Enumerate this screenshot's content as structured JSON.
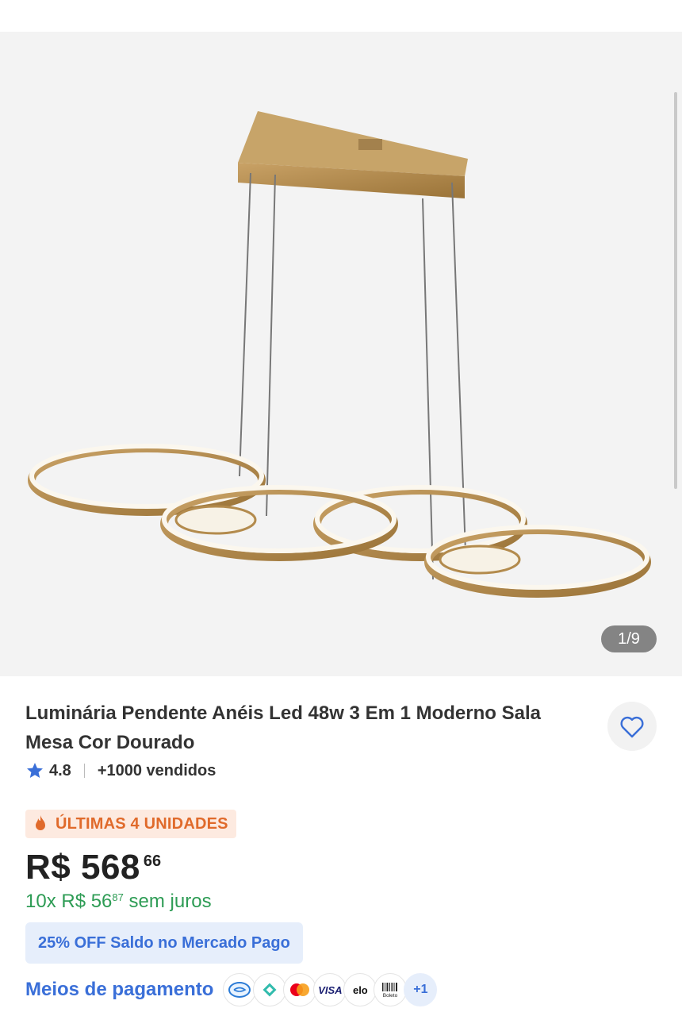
{
  "gallery": {
    "counter": "1/9"
  },
  "product": {
    "title": "Luminária Pendente Anéis Led 48w 3 Em 1 Moderno Sala Mesa Cor Dourado",
    "rating": "4.8",
    "sold": "+1000 vendidos",
    "urgency": "ÚLTIMAS 4 UNIDADES",
    "price_main": "R$ 568",
    "price_cents": "66",
    "installments_prefix": "10x R$ 56",
    "installments_cents": "87",
    "installments_suffix": " sem juros",
    "promo": "25% OFF Saldo no Mercado Pago"
  },
  "payments": {
    "label": "Meios de pagamento",
    "methods": [
      "mercado-pago-icon",
      "pix-icon",
      "mastercard-icon",
      "visa-icon",
      "elo-icon",
      "boleto-icon"
    ],
    "visa_text": "VISA",
    "elo_text": "elo",
    "boleto_text": "Boleto",
    "more": "+1"
  },
  "colors": {
    "accent_blue": "#3a6fd8",
    "green": "#2e9c55",
    "urgency_orange": "#e06a2b",
    "gold": "#b38b4d"
  }
}
